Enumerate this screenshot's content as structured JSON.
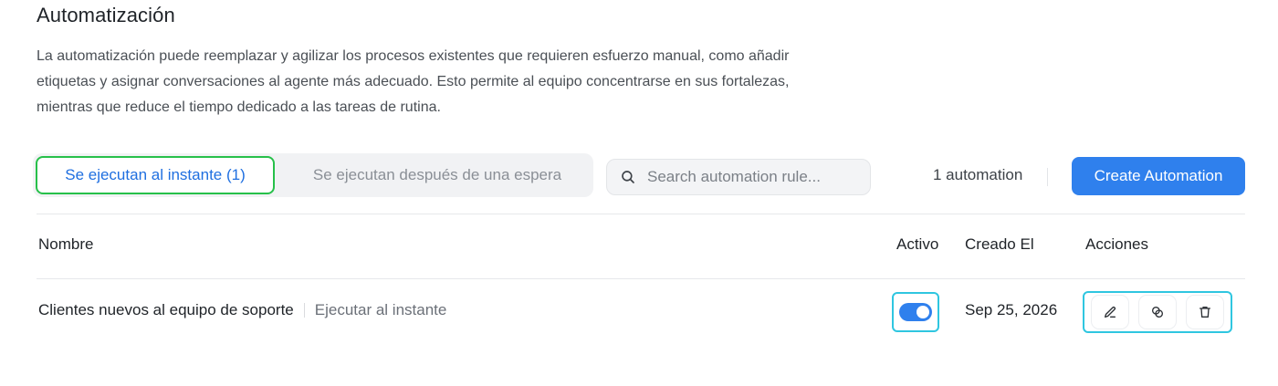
{
  "page": {
    "title": "Automatización",
    "description_lines": [
      "La automatización puede reemplazar y agilizar los procesos existentes que requieren esfuerzo manual, como añadir",
      "etiquetas y asignar conversaciones al agente más adecuado. Esto permite al equipo concentrarse en sus fortalezas,",
      "mientras que reduce el tiempo dedicado a las tareas de rutina."
    ]
  },
  "tabs": [
    {
      "label": "Se ejecutan al instante (1)",
      "active": true
    },
    {
      "label": "Se ejecutan después de una espera",
      "active": false
    }
  ],
  "search": {
    "placeholder": "Search automation rule...",
    "value": "",
    "icon": "search-icon"
  },
  "toolbar": {
    "count_label": "1 automation",
    "create_label": "Create Automation"
  },
  "table": {
    "headers": {
      "name": "Nombre",
      "active": "Activo",
      "created": "Creado El",
      "actions": "Acciones"
    },
    "rows": [
      {
        "name": "Clientes nuevos al equipo de soporte",
        "trigger": "Ejecutar al instante",
        "active": true,
        "created": "Sep 25, 2026",
        "actions": [
          "edit-icon",
          "duplicate-icon",
          "delete-icon"
        ]
      }
    ]
  },
  "colors": {
    "accent": "#2f80ed",
    "active_tab_text": "#1f6fe0",
    "tab_highlight_border": "#27c04a",
    "row_highlight_border": "#2fc6e0"
  }
}
